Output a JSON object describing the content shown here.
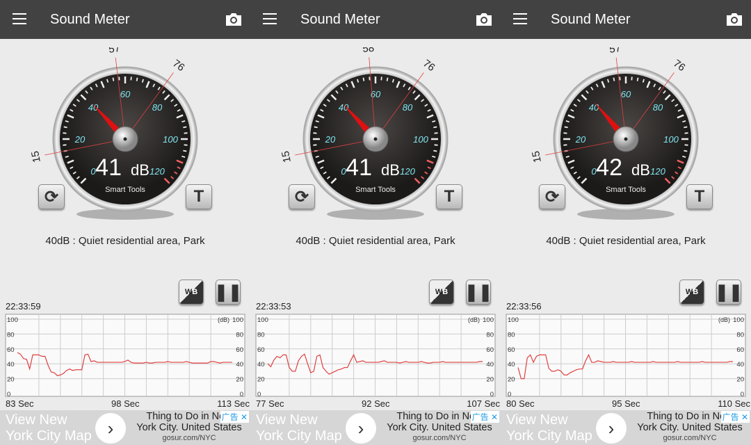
{
  "app_title": "Sound Meter",
  "icons": {
    "menu": "hamburger-menu-icon",
    "camera": "camera-icon",
    "reset": "refresh-icon",
    "timer": "T-icon",
    "wb": "white-black-toggle-icon",
    "pause": "pause-icon"
  },
  "colors": {
    "header": "#424242",
    "needle": "#e01010",
    "scale": "#7fe6f0",
    "trace": "#e04040"
  },
  "gauge": {
    "ticks": [
      "0",
      "20",
      "40",
      "60",
      "80",
      "100",
      "120"
    ],
    "unit": "dB",
    "brand": "Smart Tools"
  },
  "ad": {
    "left_line1": "View New",
    "left_line2": "York City Map",
    "right_line1": "Thing to Do in New",
    "right_line2": "York City. United States",
    "url": "gosur.com/NYC",
    "badge": "广告",
    "close": "✕",
    "arrow": "›"
  },
  "chart_axis": {
    "unit": "(dB)",
    "y_ticks": [
      "100",
      "80",
      "60",
      "40",
      "20",
      "0"
    ]
  },
  "panels": [
    {
      "value": "41",
      "min": "15",
      "avg": "57",
      "max": "76",
      "description": "40dB : Quiet residential area, Park",
      "time": "22:33:59",
      "x_labels": [
        "83 Sec",
        "98 Sec",
        "113 Sec"
      ]
    },
    {
      "value": "41",
      "min": "15",
      "avg": "58",
      "max": "76",
      "description": "40dB : Quiet residential area, Park",
      "time": "22:33:53",
      "x_labels": [
        "77 Sec",
        "92 Sec",
        "107 Sec"
      ]
    },
    {
      "value": "42",
      "min": "15",
      "avg": "57",
      "max": "76",
      "description": "40dB : Quiet residential area, Park",
      "time": "22:33:56",
      "x_labels": [
        "80 Sec",
        "95 Sec",
        "110 Sec"
      ]
    }
  ],
  "chart_data": [
    {
      "type": "line",
      "xlim": [
        83,
        113
      ],
      "ylim": [
        0,
        100
      ],
      "ylabel": "(dB)",
      "grid": true,
      "values": [
        55,
        53,
        47,
        46,
        33,
        52,
        52,
        52,
        50,
        50,
        38,
        29,
        28,
        24,
        25,
        27,
        31,
        33,
        31,
        32,
        32,
        32,
        52,
        53,
        43,
        44,
        42,
        42,
        42,
        42,
        42,
        42,
        42,
        42,
        42,
        43,
        45,
        42,
        41,
        41,
        41,
        41,
        42,
        41,
        41,
        42,
        42,
        42,
        42,
        43,
        42,
        42,
        42,
        42,
        42,
        43,
        42,
        41,
        41,
        41,
        41,
        41,
        41,
        43,
        43,
        42,
        41,
        42,
        42,
        42,
        42
      ]
    },
    {
      "type": "line",
      "xlim": [
        77,
        107
      ],
      "ylim": [
        0,
        100
      ],
      "ylabel": "(dB)",
      "grid": true,
      "values": [
        40,
        36,
        45,
        50,
        48,
        52,
        52,
        35,
        30,
        30,
        44,
        50,
        53,
        40,
        28,
        30,
        50,
        52,
        35,
        30,
        26,
        28,
        30,
        32,
        33,
        35,
        35,
        44,
        52,
        42,
        43,
        44,
        42,
        42,
        42,
        42,
        42,
        43,
        44,
        42,
        42,
        42,
        42,
        41,
        42,
        43,
        42,
        42,
        42,
        42,
        43,
        42,
        41,
        41,
        42,
        42,
        42,
        43,
        42,
        42,
        42,
        42,
        42,
        42,
        42,
        42,
        42,
        42,
        42,
        43,
        43
      ]
    },
    {
      "type": "line",
      "xlim": [
        80,
        110
      ],
      "ylim": [
        0,
        100
      ],
      "ylabel": "(dB)",
      "grid": true,
      "values": [
        35,
        20,
        20,
        48,
        52,
        42,
        50,
        52,
        52,
        52,
        34,
        30,
        30,
        32,
        30,
        25,
        25,
        28,
        30,
        32,
        33,
        33,
        44,
        52,
        42,
        42,
        44,
        43,
        42,
        42,
        42,
        43,
        42,
        42,
        42,
        42,
        42,
        43,
        42,
        42,
        42,
        42,
        42,
        42,
        43,
        42,
        42,
        42,
        42,
        42,
        42,
        42,
        43,
        42,
        42,
        42,
        42,
        42,
        42,
        42,
        43,
        42,
        42,
        42,
        42,
        42,
        42,
        42,
        42,
        43,
        43
      ]
    }
  ]
}
